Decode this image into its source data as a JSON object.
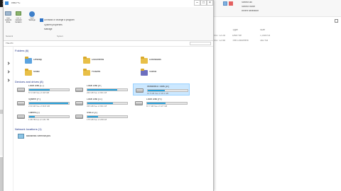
{
  "background": {
    "cmd_lines": [
      "817748 [SOC_ UPERFHEBIR]",
      "817896 [SOC_ BHKYLTSPLACEHESIE]"
    ],
    "right_toolbar": [
      "Select all",
      "Select none",
      "Invert selection"
    ],
    "right_columns": [
      "Type",
      "Size"
    ],
    "right_rows": [
      {
        "date": "2017 12:28",
        "type": "Disk File",
        "size": "1,048 KB"
      },
      {
        "date": "2017 12:58",
        "type": "Text Document",
        "size": "382 KB"
      }
    ]
  },
  "window": {
    "title": "This PC",
    "ribbon": {
      "buttons": [
        {
          "label": "Map network drive",
          "icon": "map-network-drive-icon"
        },
        {
          "label": "Add a network location",
          "icon": "network-location-icon"
        },
        {
          "label": "Open Settings",
          "icon": "settings-icon"
        }
      ],
      "system_items": [
        "Uninstall or change a program",
        "System properties",
        "Manage"
      ],
      "groups": [
        "Network",
        "System"
      ]
    },
    "address": "This PC",
    "folders_header": "Folders (6)",
    "folders": [
      "Desktop",
      "Documents",
      "Downloads",
      "Music",
      "Pictures",
      "Videos"
    ],
    "drives_header": "Devices and drives (8)",
    "drives": [
      {
        "name": "Local Disk (C:)",
        "space": "57.0 GB free of 118 GB",
        "used": 0.52,
        "selected": false
      },
      {
        "name": "Local Disk (E:)",
        "space": "230 GB free of 931 GB",
        "used": 0.75,
        "selected": false
      },
      {
        "name": "Windows 8 Tools (D:)",
        "space": "16.5 GB free of 28.4 GB",
        "used": 0.42,
        "selected": true
      },
      {
        "name": "System (F:)",
        "space": "2.03 GB free of 99.8 GB",
        "used": 0.98,
        "selected": false
      },
      {
        "name": "Local Disk (G:)",
        "space": "335 GB free of 931 GB",
        "used": 0.64,
        "selected": false
      },
      {
        "name": "Local Disk (H:)",
        "space": "67.7 GB free of 127 GB",
        "used": 0.47,
        "selected": false
      },
      {
        "name": "Games (I:)",
        "space": "1.98 TB free of 1.81 TB",
        "used": 0.15,
        "selected": false
      },
      {
        "name": "SWD2 (J:)",
        "space": "175 GB free of 238 GB",
        "used": 0.26,
        "selected": false
      }
    ],
    "network_header": "Network locations (1)",
    "network": [
      {
        "name": "Backlinks Seminar.pcs"
      }
    ]
  },
  "colors": {
    "accent": "#26a0da",
    "selection": "#cce8ff",
    "folder": "#e8bf47"
  }
}
